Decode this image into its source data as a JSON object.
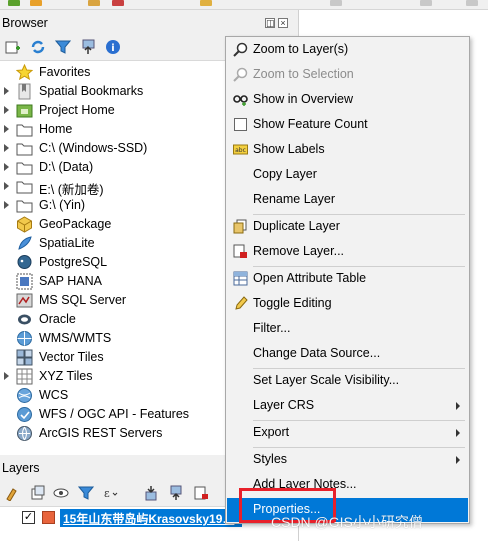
{
  "browser": {
    "title": "Browser",
    "items": [
      {
        "label": "Favorites",
        "icon": "star-icon"
      },
      {
        "label": "Spatial Bookmarks",
        "icon": "bookmark-icon"
      },
      {
        "label": "Project Home",
        "icon": "project-home-icon"
      },
      {
        "label": "Home",
        "icon": "folder-icon"
      },
      {
        "label": "C:\\ (Windows-SSD)",
        "icon": "folder-icon"
      },
      {
        "label": "D:\\ (Data)",
        "icon": "folder-icon"
      },
      {
        "label": "E:\\ (新加卷)",
        "icon": "folder-icon"
      },
      {
        "label": "G:\\ (Yin)",
        "icon": "folder-icon"
      },
      {
        "label": "GeoPackage",
        "icon": "geopackage-icon"
      },
      {
        "label": "SpatiaLite",
        "icon": "spatialite-icon"
      },
      {
        "label": "PostgreSQL",
        "icon": "postgresql-icon"
      },
      {
        "label": "SAP HANA",
        "icon": "sap-hana-icon"
      },
      {
        "label": "MS SQL Server",
        "icon": "mssql-icon"
      },
      {
        "label": "Oracle",
        "icon": "oracle-icon"
      },
      {
        "label": "WMS/WMTS",
        "icon": "wms-icon"
      },
      {
        "label": "Vector Tiles",
        "icon": "vector-tiles-icon"
      },
      {
        "label": "XYZ Tiles",
        "icon": "xyz-tiles-icon"
      },
      {
        "label": "WCS",
        "icon": "wcs-icon"
      },
      {
        "label": "WFS / OGC API - Features",
        "icon": "wfs-icon"
      },
      {
        "label": "ArcGIS REST Servers",
        "icon": "arcgis-rest-icon"
      }
    ]
  },
  "layers": {
    "title": "Layers",
    "layer_name": "15年山东带岛屿Krasovsky19…",
    "checked": "✓"
  },
  "context_menu": {
    "items": [
      {
        "label": "Zoom to Layer(s)",
        "icon": "zoom-layer-icon"
      },
      {
        "label": "Zoom to Selection",
        "icon": "zoom-selection-icon",
        "disabled": true
      },
      {
        "label": "Show in Overview",
        "icon": "overview-icon"
      },
      {
        "label": "Show Feature Count",
        "icon": "checkbox-icon"
      },
      {
        "label": "Show Labels",
        "icon": "labels-icon"
      },
      {
        "label": "Copy Layer"
      },
      {
        "label": "Rename Layer"
      },
      {
        "label": "Duplicate Layer",
        "icon": "duplicate-icon"
      },
      {
        "label": "Remove Layer...",
        "icon": "remove-layer-icon"
      },
      {
        "label": "Open Attribute Table",
        "icon": "attribute-table-icon"
      },
      {
        "label": "Toggle Editing",
        "icon": "pencil-icon"
      },
      {
        "label": "Filter..."
      },
      {
        "label": "Change Data Source..."
      },
      {
        "label": "Set Layer Scale Visibility..."
      },
      {
        "label": "Layer CRS",
        "submenu": true
      },
      {
        "label": "Export",
        "submenu": true
      },
      {
        "label": "Styles",
        "submenu": true
      },
      {
        "label": "Add Layer Notes..."
      },
      {
        "label": "Properties...",
        "highlighted": true
      }
    ]
  },
  "watermark": "CSDN @GIS小小研究僧",
  "colors": {
    "highlight": "#0078d7",
    "annotation_red": "#e8202a",
    "layer_swatch": "#e8643c"
  }
}
